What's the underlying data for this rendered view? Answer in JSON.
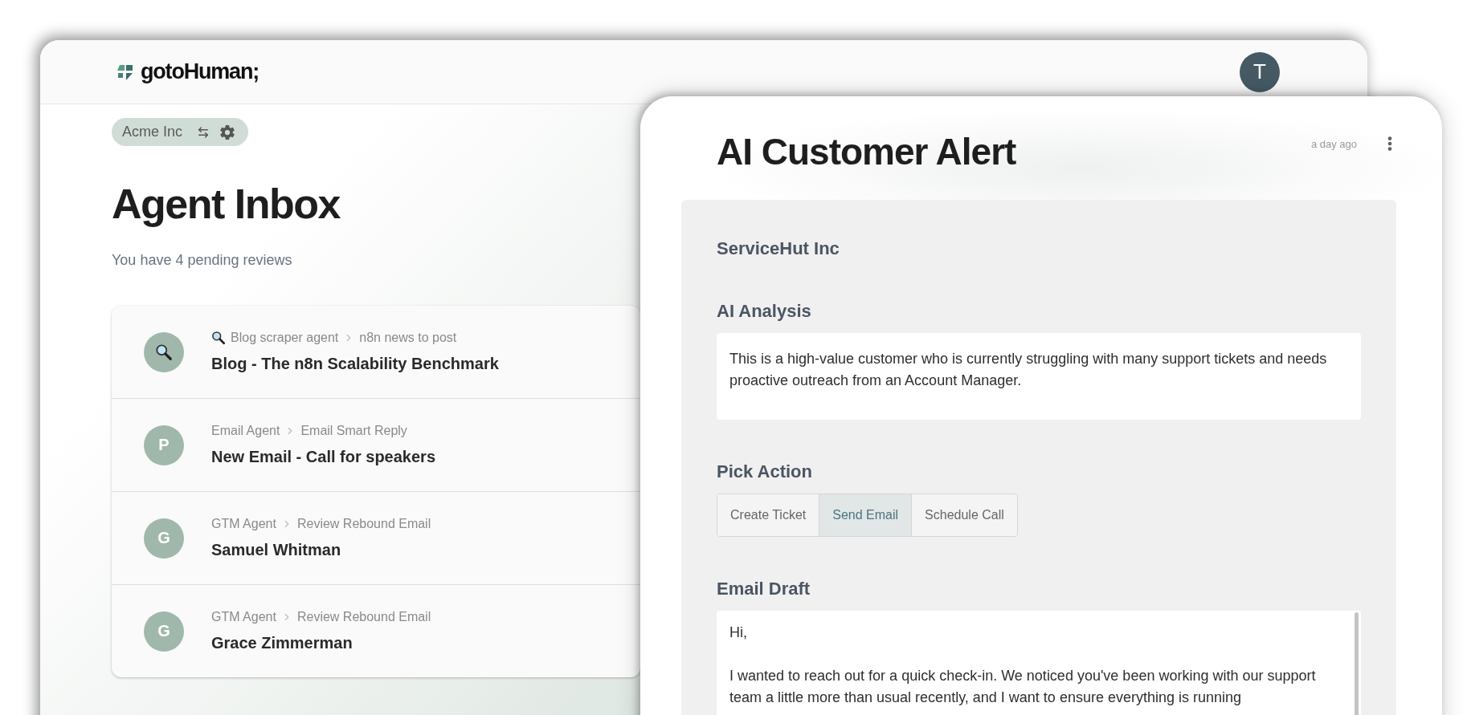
{
  "app": {
    "brand": "gotoHuman;",
    "user_initial": "T"
  },
  "workspace": {
    "name": "Acme Inc"
  },
  "inbox": {
    "title": "Agent Inbox",
    "subtitle": "You have 4 pending reviews",
    "items": [
      {
        "kind": "icon",
        "agent_icon": true,
        "agent": "Blog scraper agent",
        "flow": "n8n news to post",
        "title": "Blog - The n8n Scalability Benchmark"
      },
      {
        "kind": "letter",
        "avatar_letter": "P",
        "agent_icon": false,
        "agent": "Email Agent",
        "flow": "Email Smart Reply",
        "title": "New Email - Call for speakers"
      },
      {
        "kind": "letter",
        "avatar_letter": "G",
        "agent_icon": false,
        "agent": "GTM Agent",
        "flow": "Review Rebound Email",
        "title": "Samuel Whitman"
      },
      {
        "kind": "letter",
        "avatar_letter": "G",
        "agent_icon": false,
        "agent": "GTM Agent",
        "flow": "Review Rebound Email",
        "title": "Grace Zimmerman"
      }
    ]
  },
  "review": {
    "title": "AI Customer Alert",
    "time": "a day ago",
    "company": "ServiceHut Inc",
    "sections": [
      {
        "kind": "text",
        "label": "AI Analysis",
        "text": "This is a high-value customer who is currently struggling with many support tickets and needs proactive outreach from an Account Manager."
      },
      {
        "kind": "choice",
        "label": "Pick Action",
        "options": [
          {
            "label": "Create Ticket",
            "selected": false
          },
          {
            "label": "Send Email",
            "selected": true
          },
          {
            "label": "Schedule Call",
            "selected": false
          }
        ]
      },
      {
        "kind": "textarea",
        "label": "Email Draft",
        "paragraphs": [
          "Hi,",
          "I wanted to reach out for a quick check-in. We noticed you've been working with our support team a little more than usual recently, and I want to ensure everything is running"
        ]
      }
    ]
  }
}
